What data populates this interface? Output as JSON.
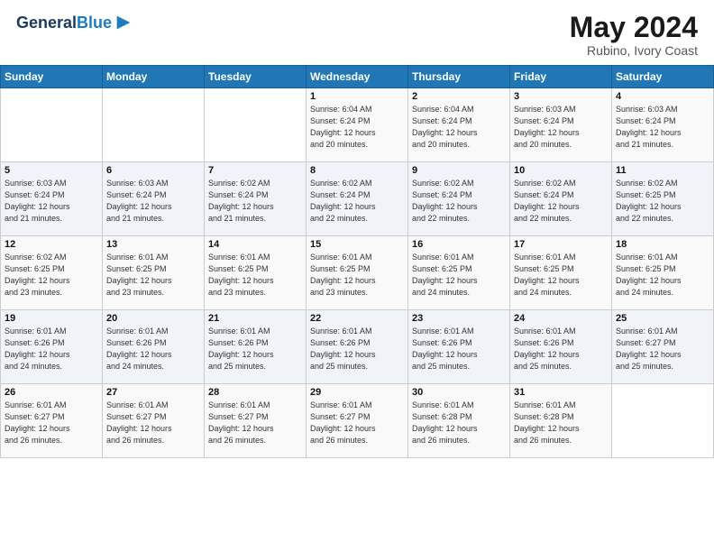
{
  "header": {
    "logo_general": "General",
    "logo_blue": "Blue",
    "month": "May 2024",
    "location": "Rubino, Ivory Coast"
  },
  "days_of_week": [
    "Sunday",
    "Monday",
    "Tuesday",
    "Wednesday",
    "Thursday",
    "Friday",
    "Saturday"
  ],
  "weeks": [
    [
      {
        "day": "",
        "info": ""
      },
      {
        "day": "",
        "info": ""
      },
      {
        "day": "",
        "info": ""
      },
      {
        "day": "1",
        "info": "Sunrise: 6:04 AM\nSunset: 6:24 PM\nDaylight: 12 hours\nand 20 minutes."
      },
      {
        "day": "2",
        "info": "Sunrise: 6:04 AM\nSunset: 6:24 PM\nDaylight: 12 hours\nand 20 minutes."
      },
      {
        "day": "3",
        "info": "Sunrise: 6:03 AM\nSunset: 6:24 PM\nDaylight: 12 hours\nand 20 minutes."
      },
      {
        "day": "4",
        "info": "Sunrise: 6:03 AM\nSunset: 6:24 PM\nDaylight: 12 hours\nand 21 minutes."
      }
    ],
    [
      {
        "day": "5",
        "info": "Sunrise: 6:03 AM\nSunset: 6:24 PM\nDaylight: 12 hours\nand 21 minutes."
      },
      {
        "day": "6",
        "info": "Sunrise: 6:03 AM\nSunset: 6:24 PM\nDaylight: 12 hours\nand 21 minutes."
      },
      {
        "day": "7",
        "info": "Sunrise: 6:02 AM\nSunset: 6:24 PM\nDaylight: 12 hours\nand 21 minutes."
      },
      {
        "day": "8",
        "info": "Sunrise: 6:02 AM\nSunset: 6:24 PM\nDaylight: 12 hours\nand 22 minutes."
      },
      {
        "day": "9",
        "info": "Sunrise: 6:02 AM\nSunset: 6:24 PM\nDaylight: 12 hours\nand 22 minutes."
      },
      {
        "day": "10",
        "info": "Sunrise: 6:02 AM\nSunset: 6:24 PM\nDaylight: 12 hours\nand 22 minutes."
      },
      {
        "day": "11",
        "info": "Sunrise: 6:02 AM\nSunset: 6:25 PM\nDaylight: 12 hours\nand 22 minutes."
      }
    ],
    [
      {
        "day": "12",
        "info": "Sunrise: 6:02 AM\nSunset: 6:25 PM\nDaylight: 12 hours\nand 23 minutes."
      },
      {
        "day": "13",
        "info": "Sunrise: 6:01 AM\nSunset: 6:25 PM\nDaylight: 12 hours\nand 23 minutes."
      },
      {
        "day": "14",
        "info": "Sunrise: 6:01 AM\nSunset: 6:25 PM\nDaylight: 12 hours\nand 23 minutes."
      },
      {
        "day": "15",
        "info": "Sunrise: 6:01 AM\nSunset: 6:25 PM\nDaylight: 12 hours\nand 23 minutes."
      },
      {
        "day": "16",
        "info": "Sunrise: 6:01 AM\nSunset: 6:25 PM\nDaylight: 12 hours\nand 24 minutes."
      },
      {
        "day": "17",
        "info": "Sunrise: 6:01 AM\nSunset: 6:25 PM\nDaylight: 12 hours\nand 24 minutes."
      },
      {
        "day": "18",
        "info": "Sunrise: 6:01 AM\nSunset: 6:25 PM\nDaylight: 12 hours\nand 24 minutes."
      }
    ],
    [
      {
        "day": "19",
        "info": "Sunrise: 6:01 AM\nSunset: 6:26 PM\nDaylight: 12 hours\nand 24 minutes."
      },
      {
        "day": "20",
        "info": "Sunrise: 6:01 AM\nSunset: 6:26 PM\nDaylight: 12 hours\nand 24 minutes."
      },
      {
        "day": "21",
        "info": "Sunrise: 6:01 AM\nSunset: 6:26 PM\nDaylight: 12 hours\nand 25 minutes."
      },
      {
        "day": "22",
        "info": "Sunrise: 6:01 AM\nSunset: 6:26 PM\nDaylight: 12 hours\nand 25 minutes."
      },
      {
        "day": "23",
        "info": "Sunrise: 6:01 AM\nSunset: 6:26 PM\nDaylight: 12 hours\nand 25 minutes."
      },
      {
        "day": "24",
        "info": "Sunrise: 6:01 AM\nSunset: 6:26 PM\nDaylight: 12 hours\nand 25 minutes."
      },
      {
        "day": "25",
        "info": "Sunrise: 6:01 AM\nSunset: 6:27 PM\nDaylight: 12 hours\nand 25 minutes."
      }
    ],
    [
      {
        "day": "26",
        "info": "Sunrise: 6:01 AM\nSunset: 6:27 PM\nDaylight: 12 hours\nand 26 minutes."
      },
      {
        "day": "27",
        "info": "Sunrise: 6:01 AM\nSunset: 6:27 PM\nDaylight: 12 hours\nand 26 minutes."
      },
      {
        "day": "28",
        "info": "Sunrise: 6:01 AM\nSunset: 6:27 PM\nDaylight: 12 hours\nand 26 minutes."
      },
      {
        "day": "29",
        "info": "Sunrise: 6:01 AM\nSunset: 6:27 PM\nDaylight: 12 hours\nand 26 minutes."
      },
      {
        "day": "30",
        "info": "Sunrise: 6:01 AM\nSunset: 6:28 PM\nDaylight: 12 hours\nand 26 minutes."
      },
      {
        "day": "31",
        "info": "Sunrise: 6:01 AM\nSunset: 6:28 PM\nDaylight: 12 hours\nand 26 minutes."
      },
      {
        "day": "",
        "info": ""
      }
    ]
  ]
}
